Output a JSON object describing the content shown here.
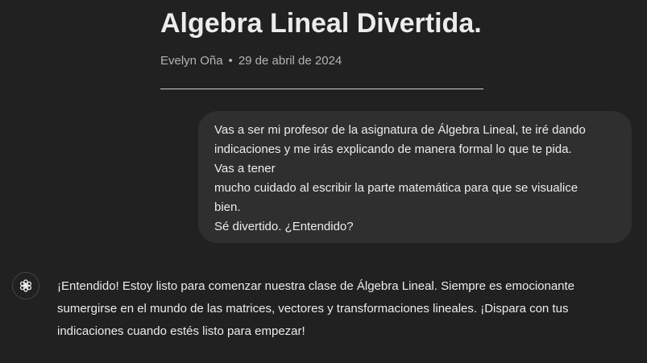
{
  "article": {
    "title": "Algebra Lineal Divertida.",
    "author": "Evelyn Oña",
    "separator": "•",
    "date": "29 de abril de 2024"
  },
  "user_message": {
    "lines": [
      "Vas a ser mi profesor de la asignatura de Álgebra Lineal, te iré dando",
      "indicaciones y me irás explicando de manera formal lo que te pida.",
      "Vas a tener",
      "mucho cuidado al escribir la parte matemática para que se visualice",
      "bien.",
      "Sé divertido. ¿Entendido?"
    ]
  },
  "assistant_message": {
    "avatar_icon": "openai-logo-icon",
    "lines": [
      "¡Entendido! Estoy listo para comenzar nuestra clase de Álgebra Lineal. Siempre es emocionante",
      "sumergirse en el mundo de las matrices, vectores y transformaciones lineales. ¡Dispara con tus",
      "indicaciones cuando estés listo para empezar!"
    ]
  },
  "colors": {
    "background": "#212121",
    "bubble": "#2f2f2f",
    "text": "#ececec",
    "muted": "#b4b4b4"
  }
}
